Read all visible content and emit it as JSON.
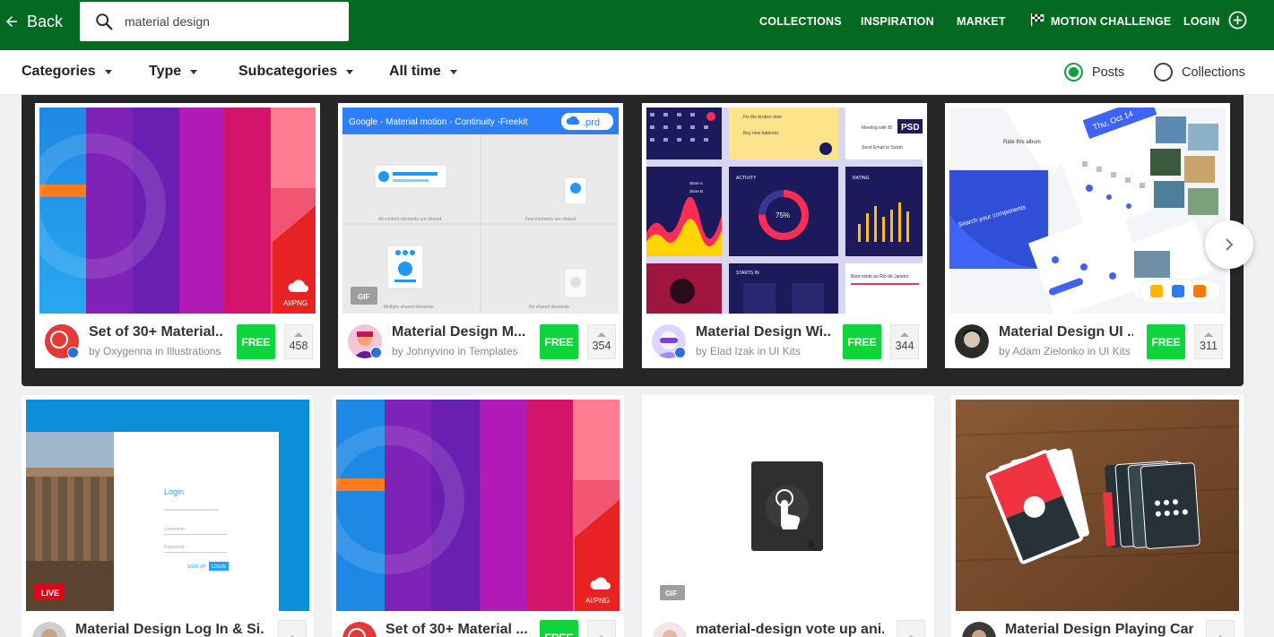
{
  "header": {
    "back_label": "Back",
    "search_value": "material design",
    "nav": [
      "COLLECTIONS",
      "INSPIRATION",
      "MARKET",
      "MOTION CHALLENGE",
      "LOGIN"
    ],
    "brand_color": "#046a22"
  },
  "filters": {
    "dropdowns": [
      "Categories",
      "Type",
      "Subcategories",
      "All time"
    ],
    "view_options": [
      "Posts",
      "Collections"
    ],
    "selected_view": "Posts"
  },
  "featured": [
    {
      "title": "Set of 30+ Material...",
      "author": "Oxygenna",
      "category": "Illustrations",
      "byline": "by Oxygenna in Illustrations",
      "price": "FREE",
      "votes": "458",
      "badge": "AI/PNG"
    },
    {
      "title": "Material Design M...",
      "author": "Johnyvino",
      "category": "Templates",
      "byline": "by Johnyvino in Templates",
      "price": "FREE",
      "votes": "354",
      "badge": "GIF",
      "thumb_header": "Google - Material motion - Continuity -Freekit",
      "thumb_tag": ".prd",
      "thumb_labels": [
        "All content elements are shared",
        "Few elements are shared",
        "Multiple shared elements",
        "No shared elements"
      ]
    },
    {
      "title": "Material Design Wi...",
      "author": "Elad Izak",
      "category": "UI Kits",
      "byline": "by Elad Izak in UI Kits",
      "price": "FREE",
      "votes": "344",
      "badge": "PSD",
      "thumb_texts": [
        "Fix the broken door",
        "Buy new batteries",
        "Meeting with Bl",
        "Send Email to Sarah",
        "ACTIVITY",
        "RATING",
        "75%",
        "STARTS IN",
        "Bem-vindo ao Rio de Janeiro",
        "Store A",
        "Store B"
      ]
    },
    {
      "title": "Material Design UI ...",
      "author": "Adam Zielonko",
      "category": "UI Kits",
      "byline": "by Adam Zielonko in UI Kits",
      "price": "FREE",
      "votes": "311",
      "thumb_texts": [
        "Thu, Oct 14",
        "Rate this album",
        "Search your components"
      ]
    }
  ],
  "grid": [
    {
      "title": "Material Design Log In & Si...",
      "badge": "LIVE",
      "thumb_texts": [
        "Login",
        "Username",
        "Password",
        "SIGN UP",
        "LOGIN"
      ]
    },
    {
      "title": "Set of 30+ Material ...",
      "price": "FREE",
      "badge": "AI/PNG"
    },
    {
      "title": "material-design vote up ani...",
      "badge": "GIF"
    },
    {
      "title": "Material Design Playing Car..."
    }
  ],
  "colors": {
    "free_green": "#0fd53c",
    "radio_green": "#0f9d3e",
    "band": "#262626",
    "verified_blue": "#2c6fd6"
  },
  "icons": [
    "arrow-left-icon",
    "search-icon",
    "checkered-flag-icon",
    "plus-circle-icon",
    "dropdown-caret-icon",
    "chevron-right-icon",
    "cloud-upload-icon",
    "upvote-arrow-icon"
  ]
}
